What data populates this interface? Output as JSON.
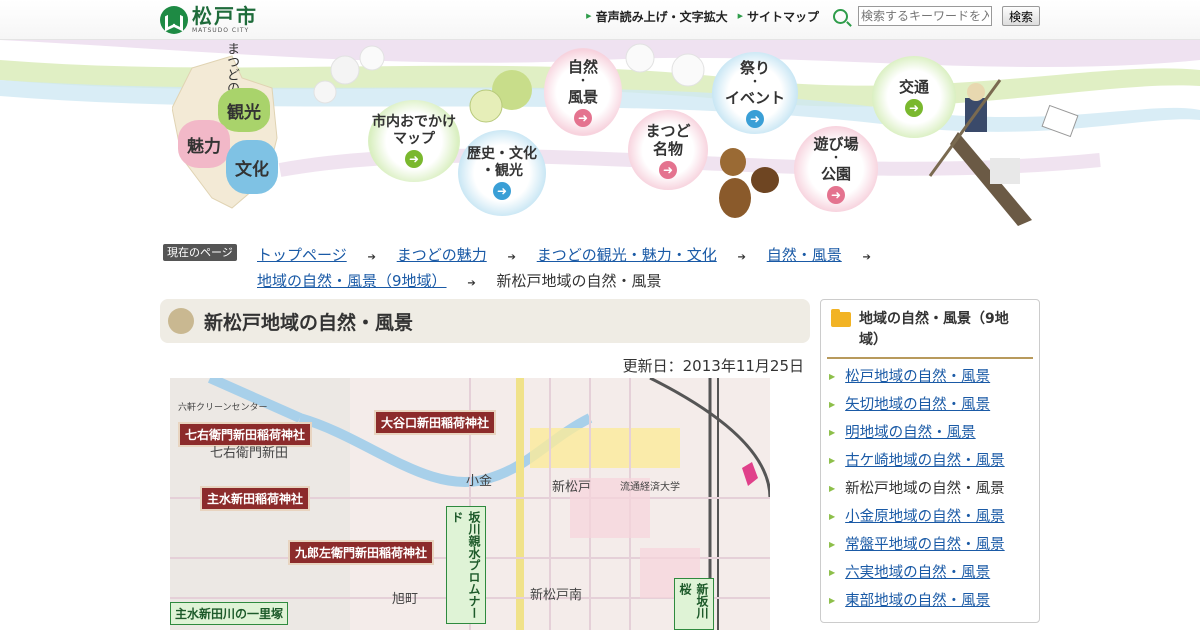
{
  "header": {
    "logo_jp": "松戸市",
    "logo_en": "MATSUDO CITY",
    "links": [
      "音声読み上げ・文字拡大",
      "サイトマップ"
    ],
    "search_placeholder": "検索するキーワードを入",
    "search_button": "検索"
  },
  "banner": {
    "map_title": "まつどの",
    "map_items": [
      "観光",
      "魅力",
      "文化"
    ],
    "nav": [
      {
        "label": "市内おでかけマップ",
        "l1": "市内おでかけ",
        "l2": "マップ"
      },
      {
        "label": "歴史・文化・観光",
        "l1": "歴史・文化",
        "l2": "・観光"
      },
      {
        "label": "自然・風景",
        "l1": "自然",
        "l2": "・",
        "l3": "風景"
      },
      {
        "label": "まつど名物",
        "l1": "まつど",
        "l2": "名物"
      },
      {
        "label": "祭り・イベント",
        "l1": "祭り",
        "l2": "・",
        "l3": "イベント"
      },
      {
        "label": "遊び場・公園",
        "l1": "遊び場",
        "l2": "・",
        "l3": "公園"
      },
      {
        "label": "交通",
        "l1": "交通"
      }
    ],
    "arrow_glyph": "➜"
  },
  "breadcrumb": {
    "badge": "現在のページ",
    "sep": "➔",
    "links": [
      "トップページ",
      "まつどの魅力",
      "まつどの観光・魅力・文化",
      "自然・風景",
      "地域の自然・風景（9地域）"
    ],
    "current": "新松戸地域の自然・風景"
  },
  "main": {
    "title": "新松戸地域の自然・風景",
    "updated": "更新日：2013年11月25日",
    "map": {
      "shrines": [
        "七右衛門新田稲荷神社",
        "大谷口新田稲荷神社",
        "主水新田稲荷神社",
        "九郎左衛門新田稲荷神社"
      ],
      "green_labels": [
        "主水新田川の一里塚"
      ],
      "vertical_labels": [
        "坂川親水プロムナード",
        "新坂川桜"
      ],
      "places": [
        "七右衛門新田",
        "小金",
        "新松戸",
        "新松戸南",
        "旭町",
        "六軒クリーンセンター",
        "流通経済大学"
      ]
    }
  },
  "sidebar": {
    "title": "地域の自然・風景（9地域）",
    "items": [
      {
        "label": "松戸地域の自然・風景",
        "current": false
      },
      {
        "label": "矢切地域の自然・風景",
        "current": false
      },
      {
        "label": "明地域の自然・風景",
        "current": false
      },
      {
        "label": "古ケ崎地域の自然・風景",
        "current": false
      },
      {
        "label": "新松戸地域の自然・風景",
        "current": true
      },
      {
        "label": "小金原地域の自然・風景",
        "current": false
      },
      {
        "label": "常盤平地域の自然・風景",
        "current": false
      },
      {
        "label": "六実地域の自然・風景",
        "current": false
      },
      {
        "label": "東部地域の自然・風景",
        "current": false
      }
    ]
  }
}
